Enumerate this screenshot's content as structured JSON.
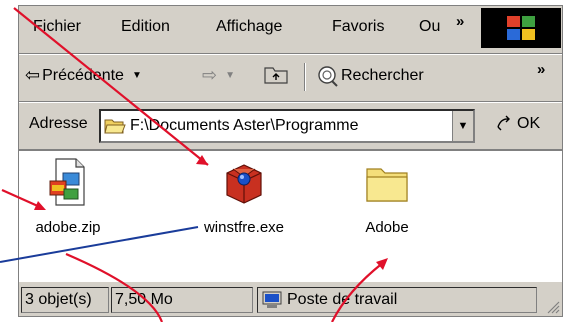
{
  "menu": {
    "items": [
      "Fichier",
      "Edition",
      "Affichage",
      "Favoris",
      "Ou"
    ],
    "overflow": "»"
  },
  "toolbar": {
    "back_label": "Précédente",
    "search_label": "Rechercher",
    "overflow": "»"
  },
  "address": {
    "label": "Adresse",
    "value": "F:\\Documents Aster\\Programme",
    "go_label": "OK"
  },
  "files": [
    {
      "name": "adobe.zip",
      "icon": "zip-file-icon"
    },
    {
      "name": "winstfre.exe",
      "icon": "installer-box-icon"
    },
    {
      "name": "Adobe",
      "icon": "folder-icon"
    }
  ],
  "status": {
    "count": "3 objet(s)",
    "size": "7,50 Mo",
    "zone": "Poste de travail"
  },
  "colors": {
    "window": "#d4d0c8",
    "annotation_red": "#e0102a",
    "annotation_blue": "#1a3c9a"
  }
}
